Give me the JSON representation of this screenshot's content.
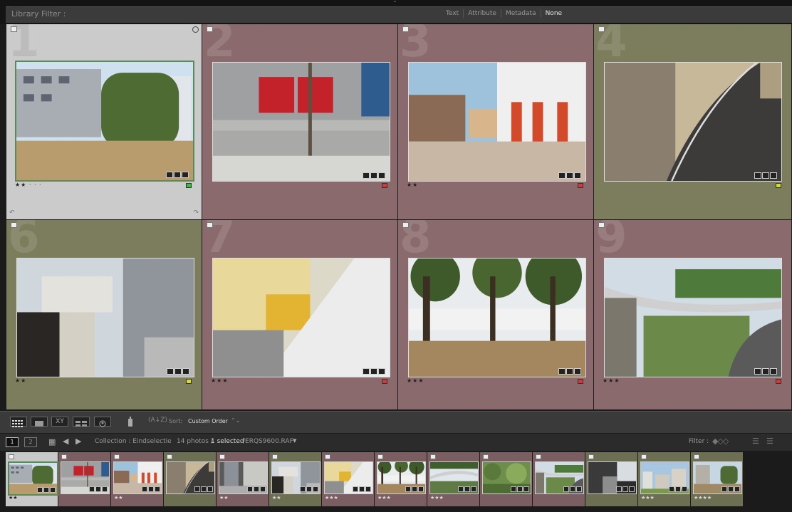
{
  "filter_bar": {
    "title": "Library Filter :",
    "tabs": [
      "Text",
      "Attribute",
      "Metadata",
      "None"
    ],
    "selected_tab": "None"
  },
  "grid": {
    "cells": [
      {
        "num": "1",
        "label_color": "gray",
        "color_dot": "#3cba3c",
        "stars": "★★ · · ·",
        "selected": true,
        "scene": "hedge"
      },
      {
        "num": "2",
        "label_color": "red",
        "color_dot": "#d23a3a",
        "stars": "",
        "selected": false,
        "scene": "wall"
      },
      {
        "num": "3",
        "label_color": "red",
        "color_dot": "#d23a3a",
        "stars": "★★",
        "selected": false,
        "scene": "plaza"
      },
      {
        "num": "4",
        "label_color": "green",
        "color_dot": "#d8d832",
        "stars": "",
        "selected": false,
        "scene": "road"
      },
      {
        "num": "6",
        "label_color": "green",
        "color_dot": "#d8d832",
        "stars": "★★",
        "selected": false,
        "scene": "stairs"
      },
      {
        "num": "7",
        "label_color": "red",
        "color_dot": "#d23a3a",
        "stars": "★★★",
        "selected": false,
        "scene": "yellow"
      },
      {
        "num": "8",
        "label_color": "red",
        "color_dot": "#d23a3a",
        "stars": "★★★",
        "selected": false,
        "scene": "trees"
      },
      {
        "num": "9",
        "label_color": "red",
        "color_dot": "#d23a3a",
        "stars": "★★★",
        "selected": false,
        "scene": "overpass"
      }
    ]
  },
  "toolbar": {
    "sort_label": "Sort:",
    "sort_value": "Custom Order",
    "view_buttons": [
      "grid-view",
      "loupe-view",
      "compare-view",
      "survey-view",
      "people-view"
    ]
  },
  "filmstrip_header": {
    "monitor1": "1",
    "monitor2": "2",
    "collection": "Collection : Eindselectie",
    "count": "14 photos /",
    "selected": "1 selected",
    "file": "/ERQS9600.RAF",
    "filter_label": "Filter :"
  },
  "filmstrip": [
    {
      "label_color": "sel",
      "stars": "★★",
      "scene": "hedge"
    },
    {
      "label_color": "red",
      "stars": "",
      "scene": "wall"
    },
    {
      "label_color": "red",
      "stars": "★★",
      "scene": "plaza"
    },
    {
      "label_color": "green",
      "stars": "",
      "scene": "road"
    },
    {
      "label_color": "red",
      "stars": "★★",
      "scene": "glass"
    },
    {
      "label_color": "green",
      "stars": "★★",
      "scene": "stairs"
    },
    {
      "label_color": "red",
      "stars": "★★★",
      "scene": "yellow"
    },
    {
      "label_color": "red",
      "stars": "★★★",
      "scene": "trees"
    },
    {
      "label_color": "red",
      "stars": "★★★",
      "scene": "park"
    },
    {
      "label_color": "red",
      "stars": "",
      "scene": "greenery"
    },
    {
      "label_color": "red",
      "stars": "",
      "scene": "overpass"
    },
    {
      "label_color": "green",
      "stars": "",
      "scene": "tunnel"
    },
    {
      "label_color": "green",
      "stars": "★★★",
      "scene": "city"
    },
    {
      "label_color": "green",
      "stars": "★★★★",
      "scene": "hedge2"
    }
  ]
}
